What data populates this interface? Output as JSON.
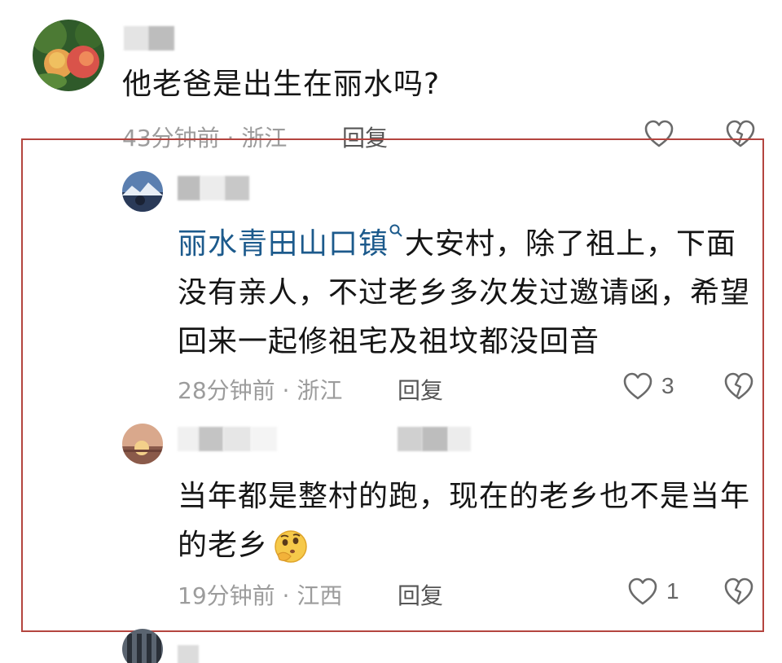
{
  "comments": [
    {
      "text": "他老爸是出生在丽水吗?",
      "time_location": "43分钟前 · 浙江",
      "reply_label": "回复",
      "likes": ""
    }
  ],
  "replies": [
    {
      "keyword": "丽水青田山口镇",
      "line1_rest": "大安村，除了祖上，下面",
      "line2": "没有亲人，不过老乡多次发过邀请函，希望",
      "line3": "回来一起修祖宅及祖坟都没回音",
      "time_location": "28分钟前 · 浙江",
      "reply_label": "回复",
      "likes": "3"
    },
    {
      "line1": "当年都是整村的跑，现在的老乡也不是当年",
      "line2": "的老乡",
      "time_location": "19分钟前 · 江西",
      "reply_label": "回复",
      "likes": "1"
    }
  ],
  "icons": {
    "like": "heart-outline-icon",
    "dislike": "broken-heart-icon",
    "keyword_search": "search-icon",
    "emoji": "thinking-face-emoji"
  },
  "colors": {
    "highlight_border": "#b4453f",
    "keyword": "#1c5a8c",
    "meta": "#9c9c9c"
  }
}
